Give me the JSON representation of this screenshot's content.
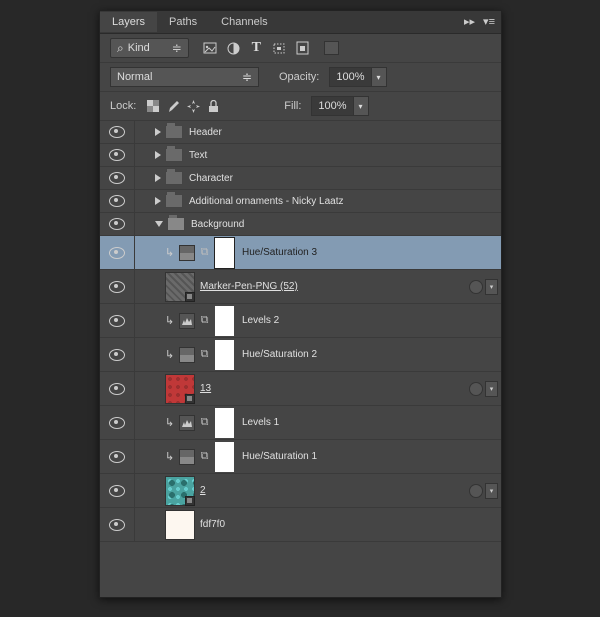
{
  "tabs": {
    "layers": "Layers",
    "paths": "Paths",
    "channels": "Channels"
  },
  "filter": {
    "kind": "Kind"
  },
  "blend": {
    "mode": "Normal",
    "opacity_label": "Opacity:",
    "opacity_value": "100%"
  },
  "lock": {
    "label": "Lock:",
    "fill_label": "Fill:",
    "fill_value": "100%"
  },
  "folders": {
    "header": "Header",
    "text": "Text",
    "character": "Character",
    "ornaments": "Additional ornaments - Nicky Laatz",
    "background": "Background"
  },
  "layers": {
    "hue3": "Hue/Saturation 3",
    "marker": "Marker-Pen-PNG (52)",
    "levels2": "Levels 2",
    "hue2": "Hue/Saturation 2",
    "l13": "13",
    "levels1": "Levels 1",
    "hue1": "Hue/Saturation 1",
    "l2": "2",
    "cream": "fdf7f0"
  }
}
